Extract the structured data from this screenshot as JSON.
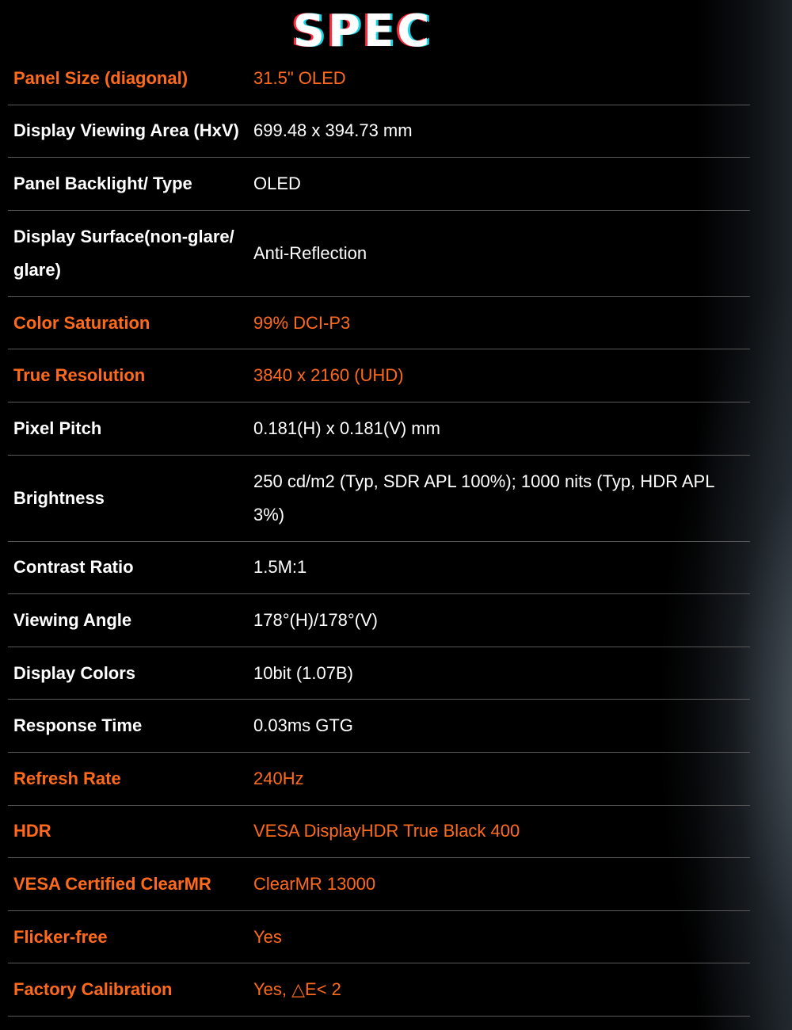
{
  "title": "SPEC",
  "specs": [
    {
      "label": "Panel Size (diagonal)",
      "value": "31.5\" OLED",
      "highlight": true
    },
    {
      "label": "Display Viewing Area (HxV)",
      "value": "699.48 x 394.73 mm",
      "highlight": false
    },
    {
      "label": "Panel Backlight/ Type",
      "value": "OLED",
      "highlight": false
    },
    {
      "label": "Display Surface(non-glare/ glare)",
      "value": "Anti-Reflection",
      "highlight": false
    },
    {
      "label": "Color Saturation",
      "value": "99% DCI-P3",
      "highlight": true
    },
    {
      "label": "True Resolution",
      "value": "3840 x 2160 (UHD)",
      "highlight": true
    },
    {
      "label": "Pixel Pitch",
      "value": "0.181(H) x 0.181(V) mm",
      "highlight": false
    },
    {
      "label": "Brightness",
      "value": "250 cd/m2 (Typ, SDR APL 100%); 1000 nits (Typ, HDR APL 3%)",
      "highlight": false
    },
    {
      "label": "Contrast Ratio",
      "value": "1.5M:1",
      "highlight": false
    },
    {
      "label": "Viewing Angle",
      "value": "178°(H)/178°(V)",
      "highlight": false
    },
    {
      "label": "Display Colors",
      "value": "10bit (1.07B)",
      "highlight": false
    },
    {
      "label": "Response Time",
      "value": "0.03ms GTG",
      "highlight": false
    },
    {
      "label": "Refresh Rate",
      "value": "240Hz",
      "highlight": true
    },
    {
      "label": "HDR",
      "value": "VESA DisplayHDR True Black 400",
      "highlight": true
    },
    {
      "label": "VESA Certified ClearMR",
      "value": "ClearMR 13000",
      "highlight": true
    },
    {
      "label": "Flicker-free",
      "value": "Yes",
      "highlight": true
    },
    {
      "label": "Factory Calibration",
      "value": "Yes, △E< 2",
      "highlight": true
    }
  ]
}
